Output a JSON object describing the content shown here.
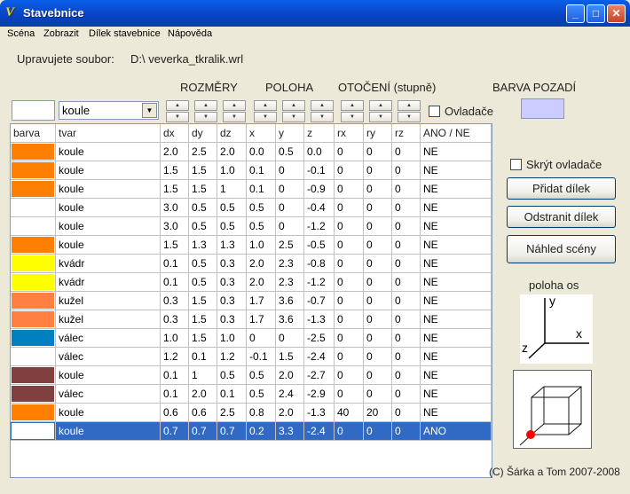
{
  "window": {
    "title": "Stavebnice",
    "icon": "app-logo-icon"
  },
  "menu": [
    "Scéna",
    "Zobrazit",
    "Dílek stavebnice",
    "Nápověda"
  ],
  "file": {
    "label": "Upravujete soubor:",
    "path": "D:\\  veverka_tkralik.wrl"
  },
  "headers": {
    "rozmery": "ROZMĚRY",
    "poloha": "POLOHA",
    "otoceni": "OTOČENÍ (stupně)",
    "barva_pozadi": "BARVA POZADÍ"
  },
  "shape_select": {
    "value": "koule"
  },
  "ovladace": {
    "label": "Ovladače",
    "checked": false
  },
  "background_color": "#ccccff",
  "table": {
    "columns": [
      "barva",
      "tvar",
      "dx",
      "dy",
      "dz",
      "x",
      "y",
      "z",
      "rx",
      "ry",
      "rz",
      "ANO / NE"
    ],
    "rows": [
      {
        "color": "#ff8000",
        "tvar": "koule",
        "dx": "2.0",
        "dy": "2.5",
        "dz": "2.0",
        "x": "0.0",
        "y": "0.5",
        "z": "0.0",
        "rx": "0",
        "ry": "0",
        "rz": "0",
        "ano": "NE"
      },
      {
        "color": "#ff8000",
        "tvar": "koule",
        "dx": "1.5",
        "dy": "1.5",
        "dz": "1.0",
        "x": "0.1",
        "y": "0",
        "z": "-0.1",
        "rx": "0",
        "ry": "0",
        "rz": "0",
        "ano": "NE"
      },
      {
        "color": "#ff8000",
        "tvar": "koule",
        "dx": "1.5",
        "dy": "1.5",
        "dz": "1",
        "x": "0.1",
        "y": "0",
        "z": "-0.9",
        "rx": "0",
        "ry": "0",
        "rz": "0",
        "ano": "NE"
      },
      {
        "color": "#ffffff",
        "tvar": "koule",
        "dx": "3.0",
        "dy": "0.5",
        "dz": "0.5",
        "x": "0.5",
        "y": "0",
        "z": "-0.4",
        "rx": "0",
        "ry": "0",
        "rz": "0",
        "ano": "NE"
      },
      {
        "color": "#ffffff",
        "tvar": "koule",
        "dx": "3.0",
        "dy": "0.5",
        "dz": "0.5",
        "x": "0.5",
        "y": "0",
        "z": "-1.2",
        "rx": "0",
        "ry": "0",
        "rz": "0",
        "ano": "NE"
      },
      {
        "color": "#ff8000",
        "tvar": "koule",
        "dx": "1.5",
        "dy": "1.3",
        "dz": "1.3",
        "x": "1.0",
        "y": "2.5",
        "z": "-0.5",
        "rx": "0",
        "ry": "0",
        "rz": "0",
        "ano": "NE"
      },
      {
        "color": "#ffff00",
        "tvar": "kvádr",
        "dx": "0.1",
        "dy": "0.5",
        "dz": "0.3",
        "x": "2.0",
        "y": "2.3",
        "z": "-0.8",
        "rx": "0",
        "ry": "0",
        "rz": "0",
        "ano": "NE"
      },
      {
        "color": "#ffff00",
        "tvar": "kvádr",
        "dx": "0.1",
        "dy": "0.5",
        "dz": "0.3",
        "x": "2.0",
        "y": "2.3",
        "z": "-1.2",
        "rx": "0",
        "ry": "0",
        "rz": "0",
        "ano": "NE"
      },
      {
        "color": "#ff8040",
        "tvar": "kužel",
        "dx": "0.3",
        "dy": "1.5",
        "dz": "0.3",
        "x": "1.7",
        "y": "3.6",
        "z": "-0.7",
        "rx": "0",
        "ry": "0",
        "rz": "0",
        "ano": "NE"
      },
      {
        "color": "#ff8040",
        "tvar": "kužel",
        "dx": "0.3",
        "dy": "1.5",
        "dz": "0.3",
        "x": "1.7",
        "y": "3.6",
        "z": "-1.3",
        "rx": "0",
        "ry": "0",
        "rz": "0",
        "ano": "NE"
      },
      {
        "color": "#0080c0",
        "tvar": "válec",
        "dx": "1.0",
        "dy": "1.5",
        "dz": "1.0",
        "x": "0",
        "y": "0",
        "z": "-2.5",
        "rx": "0",
        "ry": "0",
        "rz": "0",
        "ano": "NE"
      },
      {
        "color": "#ffffff",
        "tvar": "válec",
        "dx": "1.2",
        "dy": "0.1",
        "dz": "1.2",
        "x": "-0.1",
        "y": "1.5",
        "z": "-2.4",
        "rx": "0",
        "ry": "0",
        "rz": "0",
        "ano": "NE"
      },
      {
        "color": "#804040",
        "tvar": "koule",
        "dx": "0.1",
        "dy": "1",
        "dz": "0.5",
        "x": "0.5",
        "y": "2.0",
        "z": "-2.7",
        "rx": "0",
        "ry": "0",
        "rz": "0",
        "ano": "NE"
      },
      {
        "color": "#804040",
        "tvar": "válec",
        "dx": "0.1",
        "dy": "2.0",
        "dz": "0.1",
        "x": "0.5",
        "y": "2.4",
        "z": "-2.9",
        "rx": "0",
        "ry": "0",
        "rz": "0",
        "ano": "NE"
      },
      {
        "color": "#ff8000",
        "tvar": "koule",
        "dx": "0.6",
        "dy": "0.6",
        "dz": "2.5",
        "x": "0.8",
        "y": "2.0",
        "z": "-1.3",
        "rx": "40",
        "ry": "20",
        "rz": "0",
        "ano": "NE"
      },
      {
        "color": "#ffffff",
        "tvar": "koule",
        "dx": "0.7",
        "dy": "0.7",
        "dz": "0.7",
        "x": "0.2",
        "y": "3.3",
        "z": "-2.4",
        "rx": "0",
        "ry": "0",
        "rz": "0",
        "ano": "ANO",
        "selected": true
      }
    ]
  },
  "side": {
    "skryt_label": "Skrýt ovladače",
    "skryt_checked": false,
    "pridat": "Přidat dílek",
    "odstranit": "Odstranit dílek",
    "nahled": "Náhled scény",
    "poloha_os": "poloha os",
    "axis_y": "y",
    "axis_x": "x",
    "axis_z": "z"
  },
  "copyright": "(C) Šárka a Tom 2007-2008"
}
